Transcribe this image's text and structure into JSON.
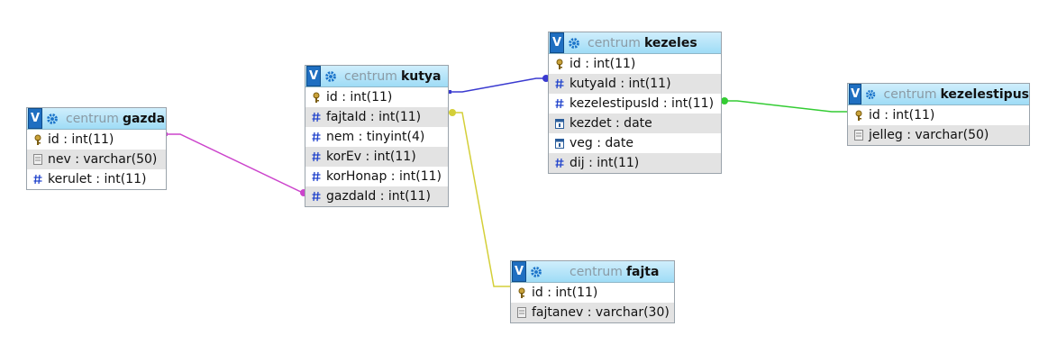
{
  "colors": {
    "rel_gazda": "#cc44cc",
    "rel_fajta": "#d4cf38",
    "rel_kezeles": "#3a3ad0",
    "rel_kezelestipus": "#33cc33",
    "header_gradient_top": "#cfeefc",
    "header_gradient_bottom": "#9fdcf6"
  },
  "tables": {
    "gazda": {
      "db": "centrum",
      "name": "gazda",
      "rows": [
        {
          "text": "id : int(11)",
          "icon": "key-icon"
        },
        {
          "text": "nev : varchar(50)",
          "icon": "text-field-icon"
        },
        {
          "text": "kerulet : int(11)",
          "icon": "hash-icon"
        }
      ]
    },
    "kutya": {
      "db": "centrum",
      "name": "kutya",
      "rows": [
        {
          "text": "id : int(11)",
          "icon": "key-icon"
        },
        {
          "text": "fajtaId : int(11)",
          "icon": "hash-icon"
        },
        {
          "text": "nem : tinyint(4)",
          "icon": "hash-icon"
        },
        {
          "text": "korEv : int(11)",
          "icon": "hash-icon"
        },
        {
          "text": "korHonap : int(11)",
          "icon": "hash-icon"
        },
        {
          "text": "gazdaId : int(11)",
          "icon": "hash-icon"
        }
      ]
    },
    "kezeles": {
      "db": "centrum",
      "name": "kezeles",
      "rows": [
        {
          "text": "id : int(11)",
          "icon": "key-icon"
        },
        {
          "text": "kutyaId : int(11)",
          "icon": "hash-icon"
        },
        {
          "text": "kezelestipusId : int(11)",
          "icon": "hash-icon"
        },
        {
          "text": "kezdet : date",
          "icon": "calendar-icon"
        },
        {
          "text": "veg : date",
          "icon": "calendar-icon"
        },
        {
          "text": "dij : int(11)",
          "icon": "hash-icon"
        }
      ]
    },
    "kezelestipus": {
      "db": "centrum",
      "name": "kezelestipus",
      "rows": [
        {
          "text": "id : int(11)",
          "icon": "key-icon"
        },
        {
          "text": "jelleg : varchar(50)",
          "icon": "text-field-icon"
        }
      ]
    },
    "fajta": {
      "db": "centrum",
      "name": "fajta",
      "rows": [
        {
          "text": "id : int(11)",
          "icon": "key-icon"
        },
        {
          "text": "fajtanev : varchar(30)",
          "icon": "text-field-icon"
        }
      ]
    }
  },
  "ui": {
    "toggle_label": "V"
  }
}
